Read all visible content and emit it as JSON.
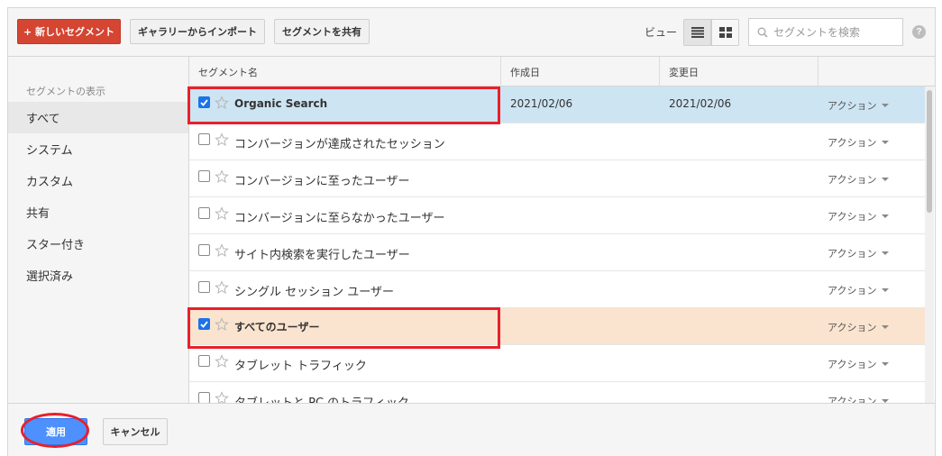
{
  "toolbar": {
    "new_segment": "+ 新しいセグメント",
    "import_gallery": "ギャラリーからインポート",
    "share_segment": "セグメントを共有",
    "view_label": "ビュー",
    "search_placeholder": "セグメントを検索",
    "help": "?"
  },
  "sidebar": {
    "title": "セグメントの表示",
    "items": [
      {
        "label": "すべて"
      },
      {
        "label": "システム"
      },
      {
        "label": "カスタム"
      },
      {
        "label": "共有"
      },
      {
        "label": "スター付き"
      },
      {
        "label": "選択済み"
      }
    ]
  },
  "table": {
    "columns": [
      "セグメント名",
      "作成日",
      "変更日",
      ""
    ],
    "action_label": "アクション",
    "rows": [
      {
        "name": "Organic Search",
        "created": "2021/02/06",
        "modified": "2021/02/06",
        "checked": true
      },
      {
        "name": "コンバージョンが達成されたセッション",
        "created": "",
        "modified": "",
        "checked": false
      },
      {
        "name": "コンバージョンに至ったユーザー",
        "created": "",
        "modified": "",
        "checked": false
      },
      {
        "name": "コンバージョンに至らなかったユーザー",
        "created": "",
        "modified": "",
        "checked": false
      },
      {
        "name": "サイト内検索を実行したユーザー",
        "created": "",
        "modified": "",
        "checked": false
      },
      {
        "name": "シングル セッション ユーザー",
        "created": "",
        "modified": "",
        "checked": false
      },
      {
        "name": "すべてのユーザー",
        "created": "",
        "modified": "",
        "checked": true
      },
      {
        "name": "タブレット トラフィック",
        "created": "",
        "modified": "",
        "checked": false
      },
      {
        "name": "タブレットと PC のトラフィック",
        "created": "",
        "modified": "",
        "checked": false
      }
    ]
  },
  "footer": {
    "apply": "適用",
    "cancel": "キャンセル"
  },
  "colors": {
    "new_button": "#d44532",
    "apply_button": "#4d90fe",
    "selected_blue": "#cde4f2",
    "selected_orange": "#fbe4cf",
    "annotation_red": "#e8202b"
  }
}
